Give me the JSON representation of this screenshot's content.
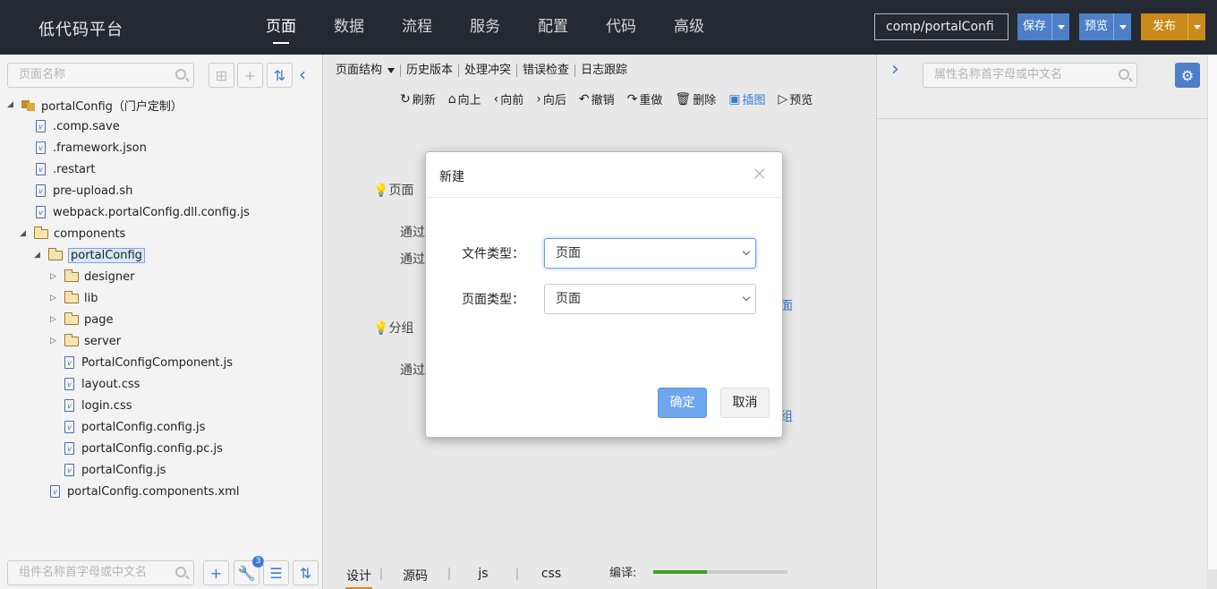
{
  "app": {
    "logo": "低代码平台"
  },
  "nav": {
    "items": [
      "页面",
      "数据",
      "流程",
      "服务",
      "配置",
      "代码",
      "高级"
    ],
    "active": 0
  },
  "header": {
    "path_value": "comp/portalConfi",
    "save_label": "保存",
    "preview_label": "预览",
    "publish_label": "发布"
  },
  "left_panel": {
    "search_placeholder": "页面名称",
    "component_search_placeholder": "组件名称首字母或中文名",
    "badge_count": "3",
    "tree": [
      {
        "label": "portalConfig（门户定制）",
        "type": "project",
        "expanded": true
      },
      {
        "label": ".comp.save",
        "type": "file"
      },
      {
        "label": ".framework.json",
        "type": "file"
      },
      {
        "label": ".restart",
        "type": "file"
      },
      {
        "label": "pre-upload.sh",
        "type": "file"
      },
      {
        "label": "webpack.portalConfig.dll.config.js",
        "type": "file"
      },
      {
        "label": "components",
        "type": "folder",
        "expanded": true
      },
      {
        "label": "portalConfig",
        "type": "folder",
        "expanded": true,
        "selected": true
      },
      {
        "label": "designer",
        "type": "folder"
      },
      {
        "label": "lib",
        "type": "folder"
      },
      {
        "label": "page",
        "type": "folder"
      },
      {
        "label": "server",
        "type": "folder"
      },
      {
        "label": "PortalConfigComponent.js",
        "type": "file"
      },
      {
        "label": "layout.css",
        "type": "file"
      },
      {
        "label": "login.css",
        "type": "file"
      },
      {
        "label": "portalConfig.config.js",
        "type": "file"
      },
      {
        "label": "portalConfig.config.pc.js",
        "type": "file"
      },
      {
        "label": "portalConfig.js",
        "type": "file"
      },
      {
        "label": "portalConfig.components.xml",
        "type": "file"
      }
    ]
  },
  "center": {
    "tabs": [
      "页面结构",
      "历史版本",
      "处理冲突",
      "错误检查",
      "日志跟踪"
    ],
    "toolbar": [
      "刷新",
      "向上",
      "向前",
      "向后",
      "撤销",
      "重做",
      "删除",
      "插图",
      "预览"
    ],
    "bg_section1": "页面",
    "bg_section2": "分组",
    "bg_line": "通过",
    "bg_link1": "面",
    "bg_link2": "组",
    "bottom_tabs": [
      "设计",
      "源码",
      "js",
      "css"
    ],
    "compile_label": "编译:",
    "compile_progress": 0.4
  },
  "right_panel": {
    "search_placeholder": "属性名称首字母或中文名"
  },
  "dialog": {
    "title": "新建",
    "close": "×",
    "file_type_label": "文件类型：",
    "file_type_value": "页面",
    "page_type_label": "页面类型：",
    "page_type_value": "页面",
    "ok_label": "确定",
    "cancel_label": "取消"
  },
  "colors": {
    "topbar": "#252a32",
    "accent": "#4d7fc9",
    "publish": "#c98a19",
    "arrow": "#e8322a"
  }
}
